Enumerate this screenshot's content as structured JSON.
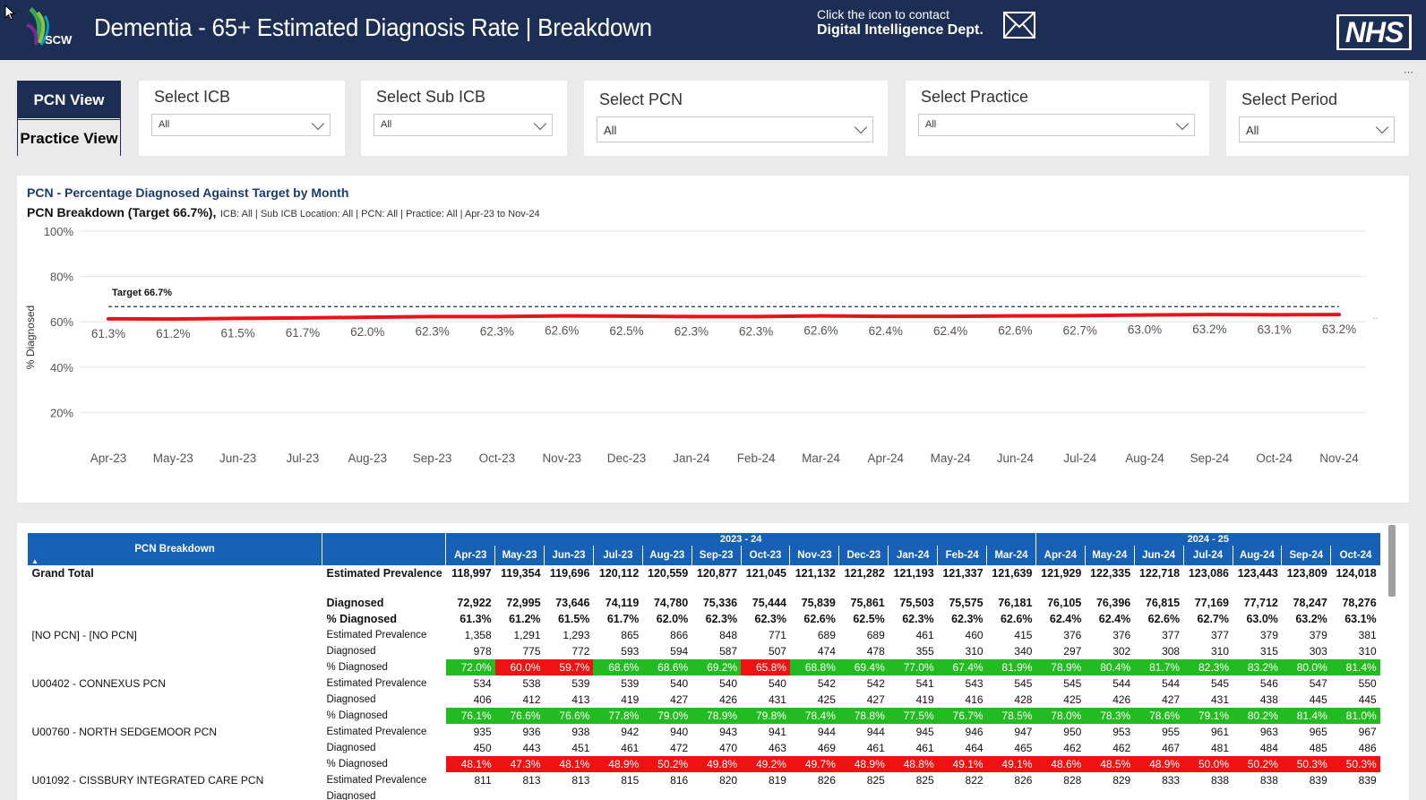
{
  "header": {
    "logo_text": "SCW",
    "title": "Dementia - 65+ Estimated Diagnosis Rate | Breakdown",
    "contact_line1": "Click the icon to contact",
    "contact_line2": "Digital Intelligence Dept.",
    "nhs_logo": "NHS",
    "mail_icon": "envelope-icon",
    "more_icon": "⋯"
  },
  "views": {
    "pcn": "PCN View",
    "practice": "Practice View"
  },
  "slicers": {
    "icb": {
      "label": "Select ICB",
      "value": "All"
    },
    "sub_icb": {
      "label": "Select Sub ICB",
      "value": "All"
    },
    "pcn": {
      "label": "Select PCN",
      "value": "All"
    },
    "practice": {
      "label": "Select Practice",
      "value": "All"
    },
    "period": {
      "label": "Select Period",
      "value": "All"
    }
  },
  "chart_data": {
    "type": "line",
    "title": "PCN - Percentage Diagnosed Against Target by Month",
    "subtitle_bold": "PCN Breakdown (Target 66.7%),",
    "subtitle": "ICB: All | Sub ICB Location: All | PCN: All | Practice: All | Apr-23 to Nov-24",
    "ylabel": "% Diagnosed",
    "xlabel": "",
    "ylim": [
      0,
      100
    ],
    "yticks": [
      "100%",
      "80%",
      "60%",
      "40%",
      "20%"
    ],
    "yticks_values": [
      100,
      80,
      60,
      40,
      20
    ],
    "categories": [
      "Apr-23",
      "May-23",
      "Jun-23",
      "Jul-23",
      "Aug-23",
      "Sep-23",
      "Oct-23",
      "Nov-23",
      "Dec-23",
      "Jan-24",
      "Feb-24",
      "Mar-24",
      "Apr-24",
      "May-24",
      "Jun-24",
      "Jul-24",
      "Aug-24",
      "Sep-24",
      "Oct-24",
      "Nov-24"
    ],
    "series": [
      {
        "values": [
          61.3,
          61.2,
          61.5,
          61.7,
          62.0,
          62.3,
          62.3,
          62.6,
          62.5,
          62.3,
          62.3,
          62.6,
          62.4,
          62.4,
          62.6,
          62.7,
          63.0,
          63.2,
          63.1,
          63.2
        ],
        "labels": [
          "61.3%",
          "61.2%",
          "61.5%",
          "61.7%",
          "62.0%",
          "62.3%",
          "62.3%",
          "62.6%",
          "62.5%",
          "62.3%",
          "62.3%",
          "62.6%",
          "62.4%",
          "62.4%",
          "62.6%",
          "62.7%",
          "63.0%",
          "63.2%",
          "63.1%",
          "63.2%"
        ],
        "color": "#e8141c"
      }
    ],
    "target": {
      "value": 66.7,
      "label": "Target 66.7%",
      "color": "#1c2e54"
    },
    "grid": true,
    "legend": "none"
  },
  "table": {
    "breakdown_header": "PCN Breakdown",
    "year_groups": [
      {
        "label": "2023 - 24",
        "span": 12
      },
      {
        "label": "2024 - 25",
        "span": 7
      }
    ],
    "months": [
      "Apr-23",
      "May-23",
      "Jun-23",
      "Jul-23",
      "Aug-23",
      "Sep-23",
      "Oct-23",
      "Nov-23",
      "Dec-23",
      "Jan-24",
      "Feb-24",
      "Mar-24",
      "Apr-24",
      "May-24",
      "Jun-24",
      "Jul-24",
      "Aug-24",
      "Sep-24",
      "Oct-24"
    ],
    "groups": [
      {
        "pcn": "Grand Total",
        "grand": true,
        "rows": [
          {
            "metric": "Estimated Prevalence",
            "values": [
              "118,997",
              "119,354",
              "119,696",
              "120,112",
              "120,559",
              "120,877",
              "121,045",
              "121,132",
              "121,282",
              "121,193",
              "121,337",
              "121,639",
              "121,929",
              "122,335",
              "122,718",
              "123,086",
              "123,443",
              "123,809",
              "124,018"
            ]
          },
          {
            "metric": "Diagnosed",
            "values": [
              "72,922",
              "72,995",
              "73,646",
              "74,119",
              "74,780",
              "75,336",
              "75,444",
              "75,839",
              "75,861",
              "75,503",
              "75,575",
              "76,181",
              "76,105",
              "76,396",
              "76,815",
              "77,169",
              "77,712",
              "78,247",
              "78,276"
            ]
          },
          {
            "metric": "% Diagnosed",
            "values": [
              "61.3%",
              "61.2%",
              "61.5%",
              "61.7%",
              "62.0%",
              "62.3%",
              "62.3%",
              "62.6%",
              "62.5%",
              "62.3%",
              "62.3%",
              "62.6%",
              "62.4%",
              "62.4%",
              "62.6%",
              "62.7%",
              "63.0%",
              "63.2%",
              "63.1%"
            ]
          }
        ]
      },
      {
        "pcn": "[NO PCN] - [NO PCN]",
        "rows": [
          {
            "metric": "Estimated Prevalence",
            "values": [
              "1,358",
              "1,291",
              "1,293",
              "865",
              "866",
              "848",
              "771",
              "689",
              "689",
              "461",
              "460",
              "415",
              "376",
              "376",
              "377",
              "377",
              "379",
              "379",
              "381"
            ]
          },
          {
            "metric": "Diagnosed",
            "values": [
              "978",
              "775",
              "772",
              "593",
              "594",
              "587",
              "507",
              "474",
              "478",
              "355",
              "310",
              "340",
              "297",
              "302",
              "308",
              "310",
              "315",
              "303",
              "310"
            ]
          },
          {
            "metric": "% Diagnosed",
            "values": [
              "72.0%",
              "60.0%",
              "59.7%",
              "68.6%",
              "68.6%",
              "69.2%",
              "65.8%",
              "68.8%",
              "69.4%",
              "77.0%",
              "67.4%",
              "81.9%",
              "78.9%",
              "80.4%",
              "81.7%",
              "82.3%",
              "83.2%",
              "80.0%",
              "81.4%"
            ],
            "status": [
              "g",
              "r",
              "r",
              "g",
              "g",
              "g",
              "r",
              "g",
              "g",
              "g",
              "g",
              "g",
              "g",
              "g",
              "g",
              "g",
              "g",
              "g",
              "g"
            ]
          }
        ]
      },
      {
        "pcn": "U00402 - CONNEXUS PCN",
        "rows": [
          {
            "metric": "Estimated Prevalence",
            "values": [
              "534",
              "538",
              "539",
              "539",
              "540",
              "540",
              "540",
              "542",
              "542",
              "541",
              "543",
              "545",
              "545",
              "544",
              "544",
              "545",
              "546",
              "547",
              "550"
            ]
          },
          {
            "metric": "Diagnosed",
            "values": [
              "406",
              "412",
              "413",
              "419",
              "427",
              "426",
              "431",
              "425",
              "427",
              "419",
              "416",
              "428",
              "425",
              "426",
              "427",
              "431",
              "438",
              "445",
              "445"
            ]
          },
          {
            "metric": "% Diagnosed",
            "values": [
              "76.1%",
              "76.6%",
              "76.6%",
              "77.8%",
              "79.0%",
              "78.9%",
              "79.8%",
              "78.4%",
              "78.8%",
              "77.5%",
              "76.7%",
              "78.5%",
              "78.0%",
              "78.3%",
              "78.6%",
              "79.1%",
              "80.2%",
              "81.4%",
              "81.0%"
            ],
            "status": [
              "g",
              "g",
              "g",
              "g",
              "g",
              "g",
              "g",
              "g",
              "g",
              "g",
              "g",
              "g",
              "g",
              "g",
              "g",
              "g",
              "g",
              "g",
              "g"
            ]
          }
        ]
      },
      {
        "pcn": "U00760 - NORTH SEDGEMOOR PCN",
        "rows": [
          {
            "metric": "Estimated Prevalence",
            "values": [
              "935",
              "936",
              "938",
              "942",
              "940",
              "943",
              "941",
              "944",
              "944",
              "945",
              "946",
              "947",
              "950",
              "953",
              "955",
              "961",
              "963",
              "965",
              "967"
            ]
          },
          {
            "metric": "Diagnosed",
            "values": [
              "450",
              "443",
              "451",
              "461",
              "472",
              "470",
              "463",
              "469",
              "461",
              "461",
              "464",
              "465",
              "462",
              "462",
              "467",
              "481",
              "484",
              "485",
              "486"
            ]
          },
          {
            "metric": "% Diagnosed",
            "values": [
              "48.1%",
              "47.3%",
              "48.1%",
              "48.9%",
              "50.2%",
              "49.8%",
              "49.2%",
              "49.7%",
              "48.9%",
              "48.8%",
              "49.1%",
              "49.1%",
              "48.6%",
              "48.5%",
              "48.9%",
              "50.0%",
              "50.2%",
              "50.3%",
              "50.3%"
            ],
            "status": [
              "r",
              "r",
              "r",
              "r",
              "r",
              "r",
              "r",
              "r",
              "r",
              "r",
              "r",
              "r",
              "r",
              "r",
              "r",
              "r",
              "r",
              "r",
              "r"
            ]
          }
        ]
      },
      {
        "pcn": "U01092 - CISSBURY INTEGRATED CARE PCN",
        "rows": [
          {
            "metric": "Estimated Prevalence",
            "values": [
              "811",
              "813",
              "813",
              "815",
              "816",
              "820",
              "819",
              "826",
              "825",
              "825",
              "822",
              "826",
              "828",
              "829",
              "833",
              "838",
              "838",
              "839",
              "839"
            ]
          },
          {
            "metric": "Diagnosed",
            "values": [
              "",
              "",
              "",
              "",
              "",
              "",
              "",
              "",
              "",
              "",
              "",
              "",
              "",
              "",
              "",
              "",
              "",
              "",
              ""
            ]
          }
        ]
      }
    ]
  }
}
